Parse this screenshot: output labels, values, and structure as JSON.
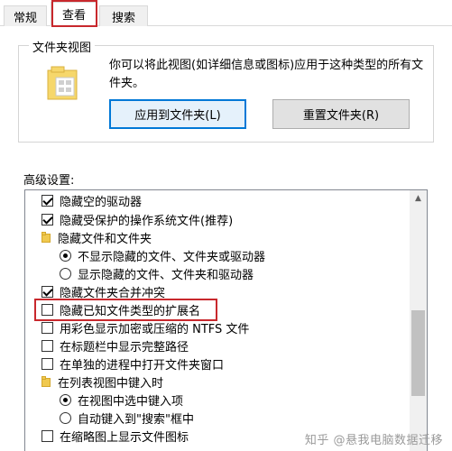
{
  "tabs": [
    {
      "label": "常规"
    },
    {
      "label": "查看"
    },
    {
      "label": "搜索"
    }
  ],
  "folder_view": {
    "title": "文件夹视图",
    "description": "你可以将此视图(如详细信息或图标)应用于这种类型的所有文件夹。",
    "apply_button": "应用到文件夹(L)",
    "reset_button": "重置文件夹(R)"
  },
  "advanced": {
    "label": "高级设置:",
    "items": [
      {
        "type": "checkbox",
        "checked": true,
        "label": "隐藏空的驱动器"
      },
      {
        "type": "checkbox",
        "checked": true,
        "label": "隐藏受保护的操作系统文件(推荐)"
      },
      {
        "type": "folder",
        "label": "隐藏文件和文件夹"
      },
      {
        "type": "radio",
        "checked": true,
        "label": "不显示隐藏的文件、文件夹或驱动器"
      },
      {
        "type": "radio",
        "checked": false,
        "label": "显示隐藏的文件、文件夹和驱动器"
      },
      {
        "type": "checkbox",
        "checked": true,
        "label": "隐藏文件夹合并冲突"
      },
      {
        "type": "checkbox",
        "checked": false,
        "label": "隐藏已知文件类型的扩展名"
      },
      {
        "type": "checkbox",
        "checked": false,
        "label": "用彩色显示加密或压缩的 NTFS 文件"
      },
      {
        "type": "checkbox",
        "checked": false,
        "label": "在标题栏中显示完整路径"
      },
      {
        "type": "checkbox",
        "checked": false,
        "label": "在单独的进程中打开文件夹窗口"
      },
      {
        "type": "folder",
        "label": "在列表视图中键入时"
      },
      {
        "type": "radio",
        "checked": true,
        "label": "在视图中选中键入项"
      },
      {
        "type": "radio",
        "checked": false,
        "label": "自动键入到\"搜索\"框中"
      },
      {
        "type": "checkbox",
        "checked": false,
        "label": "在缩略图上显示文件图标"
      }
    ]
  },
  "watermark": "知乎 @悬我电脑数据迁移",
  "colors": {
    "highlight": "#c8282d",
    "accent": "#0078d7"
  }
}
